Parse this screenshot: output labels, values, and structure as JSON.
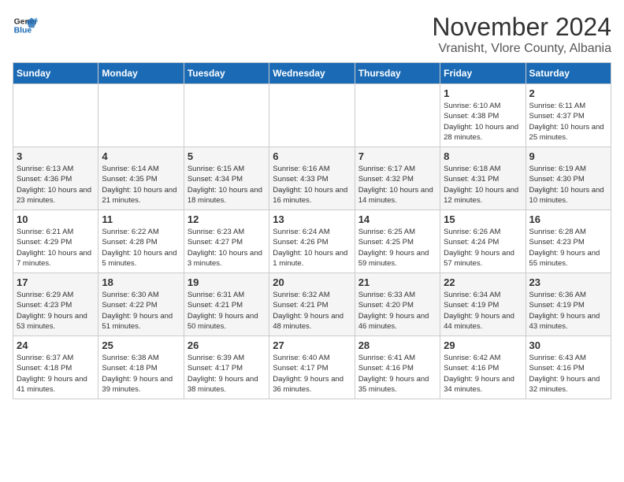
{
  "header": {
    "logo_line1": "General",
    "logo_line2": "Blue",
    "title": "November 2024",
    "subtitle": "Vranisht, Vlore County, Albania"
  },
  "days_of_week": [
    "Sunday",
    "Monday",
    "Tuesday",
    "Wednesday",
    "Thursday",
    "Friday",
    "Saturday"
  ],
  "weeks": [
    [
      {
        "day": "",
        "info": ""
      },
      {
        "day": "",
        "info": ""
      },
      {
        "day": "",
        "info": ""
      },
      {
        "day": "",
        "info": ""
      },
      {
        "day": "",
        "info": ""
      },
      {
        "day": "1",
        "info": "Sunrise: 6:10 AM\nSunset: 4:38 PM\nDaylight: 10 hours and 28 minutes."
      },
      {
        "day": "2",
        "info": "Sunrise: 6:11 AM\nSunset: 4:37 PM\nDaylight: 10 hours and 25 minutes."
      }
    ],
    [
      {
        "day": "3",
        "info": "Sunrise: 6:13 AM\nSunset: 4:36 PM\nDaylight: 10 hours and 23 minutes."
      },
      {
        "day": "4",
        "info": "Sunrise: 6:14 AM\nSunset: 4:35 PM\nDaylight: 10 hours and 21 minutes."
      },
      {
        "day": "5",
        "info": "Sunrise: 6:15 AM\nSunset: 4:34 PM\nDaylight: 10 hours and 18 minutes."
      },
      {
        "day": "6",
        "info": "Sunrise: 6:16 AM\nSunset: 4:33 PM\nDaylight: 10 hours and 16 minutes."
      },
      {
        "day": "7",
        "info": "Sunrise: 6:17 AM\nSunset: 4:32 PM\nDaylight: 10 hours and 14 minutes."
      },
      {
        "day": "8",
        "info": "Sunrise: 6:18 AM\nSunset: 4:31 PM\nDaylight: 10 hours and 12 minutes."
      },
      {
        "day": "9",
        "info": "Sunrise: 6:19 AM\nSunset: 4:30 PM\nDaylight: 10 hours and 10 minutes."
      }
    ],
    [
      {
        "day": "10",
        "info": "Sunrise: 6:21 AM\nSunset: 4:29 PM\nDaylight: 10 hours and 7 minutes."
      },
      {
        "day": "11",
        "info": "Sunrise: 6:22 AM\nSunset: 4:28 PM\nDaylight: 10 hours and 5 minutes."
      },
      {
        "day": "12",
        "info": "Sunrise: 6:23 AM\nSunset: 4:27 PM\nDaylight: 10 hours and 3 minutes."
      },
      {
        "day": "13",
        "info": "Sunrise: 6:24 AM\nSunset: 4:26 PM\nDaylight: 10 hours and 1 minute."
      },
      {
        "day": "14",
        "info": "Sunrise: 6:25 AM\nSunset: 4:25 PM\nDaylight: 9 hours and 59 minutes."
      },
      {
        "day": "15",
        "info": "Sunrise: 6:26 AM\nSunset: 4:24 PM\nDaylight: 9 hours and 57 minutes."
      },
      {
        "day": "16",
        "info": "Sunrise: 6:28 AM\nSunset: 4:23 PM\nDaylight: 9 hours and 55 minutes."
      }
    ],
    [
      {
        "day": "17",
        "info": "Sunrise: 6:29 AM\nSunset: 4:23 PM\nDaylight: 9 hours and 53 minutes."
      },
      {
        "day": "18",
        "info": "Sunrise: 6:30 AM\nSunset: 4:22 PM\nDaylight: 9 hours and 51 minutes."
      },
      {
        "day": "19",
        "info": "Sunrise: 6:31 AM\nSunset: 4:21 PM\nDaylight: 9 hours and 50 minutes."
      },
      {
        "day": "20",
        "info": "Sunrise: 6:32 AM\nSunset: 4:21 PM\nDaylight: 9 hours and 48 minutes."
      },
      {
        "day": "21",
        "info": "Sunrise: 6:33 AM\nSunset: 4:20 PM\nDaylight: 9 hours and 46 minutes."
      },
      {
        "day": "22",
        "info": "Sunrise: 6:34 AM\nSunset: 4:19 PM\nDaylight: 9 hours and 44 minutes."
      },
      {
        "day": "23",
        "info": "Sunrise: 6:36 AM\nSunset: 4:19 PM\nDaylight: 9 hours and 43 minutes."
      }
    ],
    [
      {
        "day": "24",
        "info": "Sunrise: 6:37 AM\nSunset: 4:18 PM\nDaylight: 9 hours and 41 minutes."
      },
      {
        "day": "25",
        "info": "Sunrise: 6:38 AM\nSunset: 4:18 PM\nDaylight: 9 hours and 39 minutes."
      },
      {
        "day": "26",
        "info": "Sunrise: 6:39 AM\nSunset: 4:17 PM\nDaylight: 9 hours and 38 minutes."
      },
      {
        "day": "27",
        "info": "Sunrise: 6:40 AM\nSunset: 4:17 PM\nDaylight: 9 hours and 36 minutes."
      },
      {
        "day": "28",
        "info": "Sunrise: 6:41 AM\nSunset: 4:16 PM\nDaylight: 9 hours and 35 minutes."
      },
      {
        "day": "29",
        "info": "Sunrise: 6:42 AM\nSunset: 4:16 PM\nDaylight: 9 hours and 34 minutes."
      },
      {
        "day": "30",
        "info": "Sunrise: 6:43 AM\nSunset: 4:16 PM\nDaylight: 9 hours and 32 minutes."
      }
    ]
  ]
}
